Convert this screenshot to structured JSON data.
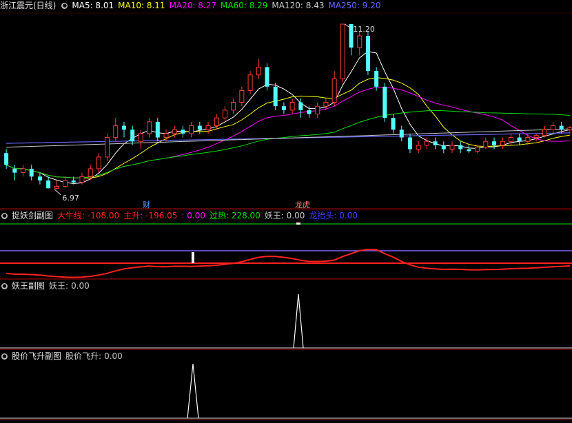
{
  "colors": {
    "bg": "#000000",
    "up": "#ff3c3c",
    "down": "#54ffff",
    "ma5": "#ffffff",
    "ma10": "#ffff00",
    "ma20": "#ff00ff",
    "ma60": "#00e000",
    "ma120": "#c8c8c8",
    "ma250": "#6464ff",
    "sep": "#b00000",
    "red": "#ff2020",
    "green": "#00e000",
    "blue": "#4040ff"
  },
  "main": {
    "title": "浙江震元(日线)",
    "ma": [
      {
        "key": "MA5",
        "val": "8.01",
        "color": "#ffffff"
      },
      {
        "key": "MA10",
        "val": "8.11",
        "color": "#ffff00"
      },
      {
        "key": "MA20",
        "val": "8.27",
        "color": "#ff00ff"
      },
      {
        "key": "MA60",
        "val": "8.29",
        "color": "#00e000"
      },
      {
        "key": "MA120",
        "val": "8.43",
        "color": "#c8c8c8"
      },
      {
        "key": "MA250",
        "val": "9.20",
        "color": "#6464ff"
      }
    ],
    "high_label": "11.20",
    "low_label": "6.97",
    "marker_cai": "财",
    "marker_longhu": "龙虎"
  },
  "sub1": {
    "title": "捉妖剑副图",
    "items": [
      {
        "key": "大牛线",
        "val": "-108.00",
        "color": "#ff2020"
      },
      {
        "key": "主升",
        "val": "-196.05",
        "color": "#ff2020"
      },
      {
        "key": "",
        "val": "0.00",
        "color": "#ff00ff"
      },
      {
        "key": "过热",
        "val": "228.00",
        "color": "#00e000"
      },
      {
        "key": "妖王",
        "val": "0.00",
        "color": "#c8c8c8"
      },
      {
        "key": "龙抬头",
        "val": "0.00",
        "color": "#4040ff"
      }
    ]
  },
  "sub2": {
    "title": "妖王副图",
    "key": "妖王",
    "val": "0.00"
  },
  "sub3": {
    "title": "股价飞升副图",
    "key": "股价飞升",
    "val": "0.00"
  },
  "chart_data": [
    {
      "type": "candlestick",
      "title": "浙江震元(日线)",
      "series": [
        {
          "name": "MA5",
          "value": 8.01
        },
        {
          "name": "MA10",
          "value": 8.11
        },
        {
          "name": "MA20",
          "value": 8.27
        },
        {
          "name": "MA60",
          "value": 8.29
        },
        {
          "name": "MA120",
          "value": 8.43
        },
        {
          "name": "MA250",
          "value": 9.2
        }
      ],
      "annotations": [
        "11.20",
        "6.97"
      ],
      "price_range": [
        6.97,
        11.2
      ],
      "candles": [
        [
          7.9,
          7.6,
          8.0,
          7.5
        ],
        [
          7.5,
          7.4,
          7.6,
          7.2
        ],
        [
          7.4,
          7.5,
          7.6,
          7.3
        ],
        [
          7.5,
          7.3,
          7.6,
          7.2
        ],
        [
          7.3,
          7.2,
          7.4,
          7.1
        ],
        [
          7.2,
          7.0,
          7.3,
          7.0
        ],
        [
          7.0,
          7.05,
          7.2,
          6.97
        ],
        [
          7.05,
          7.2,
          7.3,
          7.0
        ],
        [
          7.2,
          7.15,
          7.3,
          7.1
        ],
        [
          7.15,
          7.3,
          7.4,
          7.1
        ],
        [
          7.3,
          7.5,
          7.6,
          7.2
        ],
        [
          7.5,
          7.8,
          7.9,
          7.4
        ],
        [
          7.8,
          8.3,
          8.4,
          7.7
        ],
        [
          8.3,
          8.6,
          8.8,
          8.2
        ],
        [
          8.6,
          8.5,
          8.7,
          8.3
        ],
        [
          8.5,
          8.2,
          8.6,
          8.1
        ],
        [
          8.2,
          8.4,
          8.5,
          8.0
        ],
        [
          8.4,
          8.7,
          8.8,
          8.3
        ],
        [
          8.7,
          8.3,
          8.8,
          8.2
        ],
        [
          8.3,
          8.4,
          8.5,
          8.2
        ],
        [
          8.4,
          8.5,
          8.6,
          8.3
        ],
        [
          8.5,
          8.4,
          8.6,
          8.3
        ],
        [
          8.4,
          8.6,
          8.7,
          8.3
        ],
        [
          8.6,
          8.5,
          8.7,
          8.4
        ],
        [
          8.5,
          8.6,
          8.7,
          8.4
        ],
        [
          8.6,
          8.8,
          8.9,
          8.5
        ],
        [
          8.8,
          9.0,
          9.1,
          8.7
        ],
        [
          9.0,
          9.2,
          9.3,
          8.9
        ],
        [
          9.2,
          9.5,
          9.6,
          9.1
        ],
        [
          9.5,
          9.9,
          10.0,
          9.4
        ],
        [
          9.9,
          10.1,
          10.3,
          9.8
        ],
        [
          10.1,
          9.6,
          10.2,
          9.5
        ],
        [
          9.6,
          9.1,
          9.7,
          9.0
        ],
        [
          9.1,
          9.0,
          9.2,
          8.9
        ],
        [
          9.0,
          9.2,
          9.3,
          8.9
        ],
        [
          9.2,
          9.0,
          9.3,
          8.8
        ],
        [
          9.0,
          8.9,
          9.1,
          8.8
        ],
        [
          8.9,
          9.1,
          9.2,
          8.8
        ],
        [
          9.1,
          9.2,
          9.3,
          9.0
        ],
        [
          9.2,
          9.8,
          10.0,
          9.1
        ],
        [
          9.8,
          11.2,
          11.2,
          9.7
        ],
        [
          11.2,
          10.6,
          11.2,
          10.4
        ],
        [
          10.6,
          10.9,
          11.0,
          10.4
        ],
        [
          10.9,
          10.0,
          11.0,
          9.9
        ],
        [
          10.0,
          9.6,
          10.1,
          9.5
        ],
        [
          9.6,
          8.8,
          9.7,
          8.7
        ],
        [
          8.8,
          8.5,
          8.9,
          8.4
        ],
        [
          8.5,
          8.3,
          8.6,
          8.2
        ],
        [
          8.3,
          8.0,
          8.4,
          7.9
        ],
        [
          8.0,
          8.1,
          8.2,
          7.9
        ],
        [
          8.1,
          8.2,
          8.3,
          8.0
        ],
        [
          8.2,
          8.1,
          8.3,
          8.0
        ],
        [
          8.1,
          8.0,
          8.2,
          7.9
        ],
        [
          8.0,
          8.1,
          8.2,
          7.9
        ],
        [
          8.1,
          8.0,
          8.2,
          7.9
        ],
        [
          8.0,
          7.95,
          8.1,
          7.9
        ],
        [
          7.95,
          8.05,
          8.1,
          7.9
        ],
        [
          8.05,
          8.2,
          8.3,
          8.0
        ],
        [
          8.2,
          8.1,
          8.3,
          8.0
        ],
        [
          8.1,
          8.2,
          8.3,
          8.0
        ],
        [
          8.2,
          8.3,
          8.4,
          8.1
        ],
        [
          8.3,
          8.2,
          8.4,
          8.1
        ],
        [
          8.2,
          8.3,
          8.4,
          8.1
        ],
        [
          8.3,
          8.35,
          8.4,
          8.2
        ],
        [
          8.35,
          8.5,
          8.6,
          8.3
        ],
        [
          8.5,
          8.6,
          8.7,
          8.4
        ],
        [
          8.6,
          8.5,
          8.7,
          8.4
        ],
        [
          8.5,
          8.55,
          8.6,
          8.4
        ]
      ]
    },
    {
      "type": "line",
      "title": "捉妖剑副图",
      "series": [
        {
          "name": "大牛线",
          "value": -108.0
        },
        {
          "name": "主升",
          "value": -196.05
        },
        {
          "name": "过热",
          "value": 228.0
        },
        {
          "name": "妖王",
          "value": 0.0
        },
        {
          "name": "龙抬头",
          "value": 0.0
        }
      ]
    },
    {
      "type": "line",
      "title": "妖王副图",
      "series": [
        {
          "name": "妖王",
          "value": 0.0
        }
      ]
    },
    {
      "type": "line",
      "title": "股价飞升副图",
      "series": [
        {
          "name": "股价飞升",
          "value": 0.0
        }
      ]
    }
  ]
}
